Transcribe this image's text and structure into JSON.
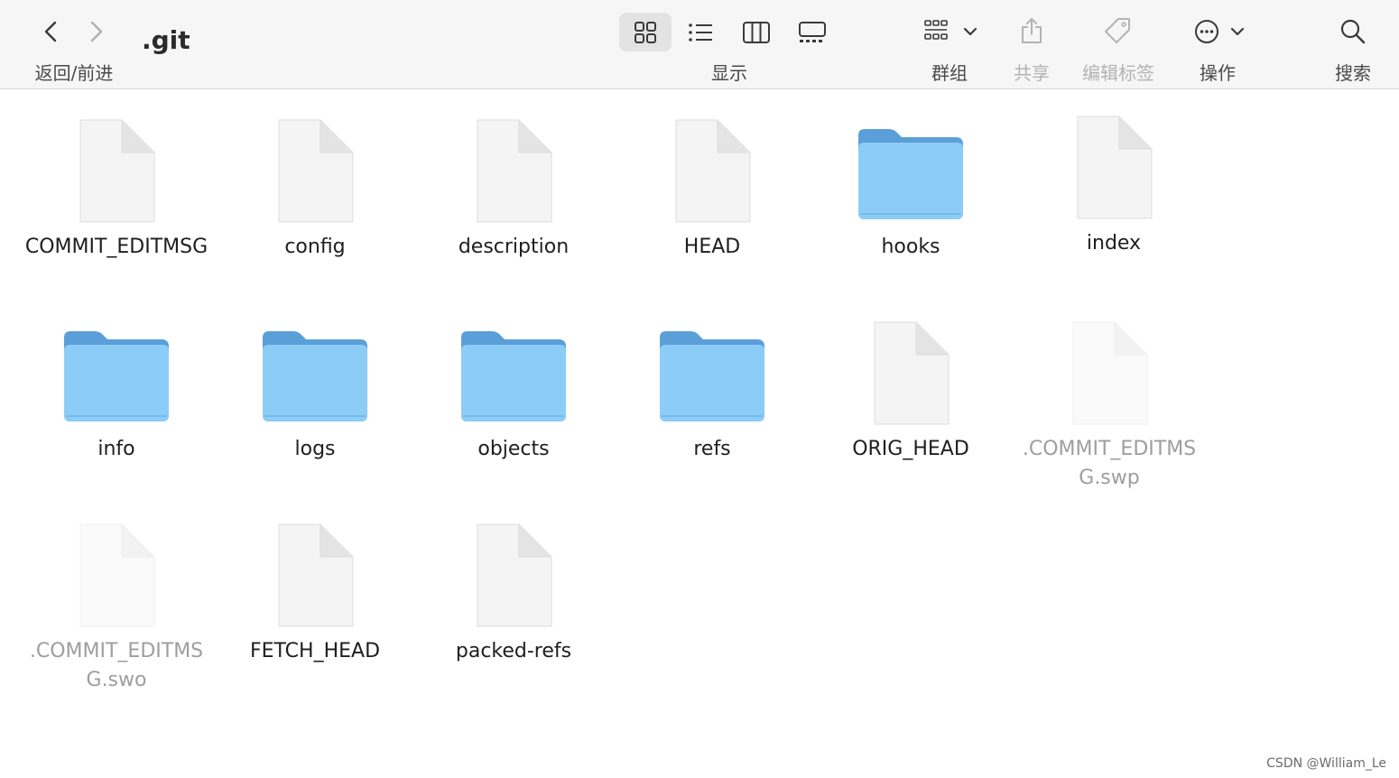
{
  "toolbar": {
    "title": ".git",
    "nav_label": "返回/前进",
    "view_label": "显示",
    "group_label": "群组",
    "share_label": "共享",
    "tags_label": "编辑标签",
    "action_label": "操作",
    "search_label": "搜索"
  },
  "items": [
    {
      "name": "COMMIT_EDITMSG",
      "kind": "file",
      "hidden": false
    },
    {
      "name": "config",
      "kind": "file",
      "hidden": false
    },
    {
      "name": "description",
      "kind": "file",
      "hidden": false
    },
    {
      "name": "HEAD",
      "kind": "file",
      "hidden": false
    },
    {
      "name": "hooks",
      "kind": "folder",
      "hidden": false
    },
    {
      "name": "index",
      "kind": "file",
      "hidden": false
    },
    {
      "name": "info",
      "kind": "folder",
      "hidden": false
    },
    {
      "name": "logs",
      "kind": "folder",
      "hidden": false
    },
    {
      "name": "objects",
      "kind": "folder",
      "hidden": false
    },
    {
      "name": "refs",
      "kind": "folder",
      "hidden": false
    },
    {
      "name": "ORIG_HEAD",
      "kind": "file",
      "hidden": false
    },
    {
      "name": ".COMMIT_EDITMSG.swp",
      "kind": "file",
      "hidden": true
    },
    {
      "name": ".COMMIT_EDITMSG.swo",
      "kind": "file",
      "hidden": true
    },
    {
      "name": "FETCH_HEAD",
      "kind": "file",
      "hidden": false
    },
    {
      "name": "packed-refs",
      "kind": "file",
      "hidden": false
    }
  ],
  "watermark": "CSDN @William_Le",
  "colors": {
    "folder_light": "#8ccdf7",
    "folder_dark": "#5a9fd8",
    "toolbar_bg": "#f6f6f6"
  }
}
